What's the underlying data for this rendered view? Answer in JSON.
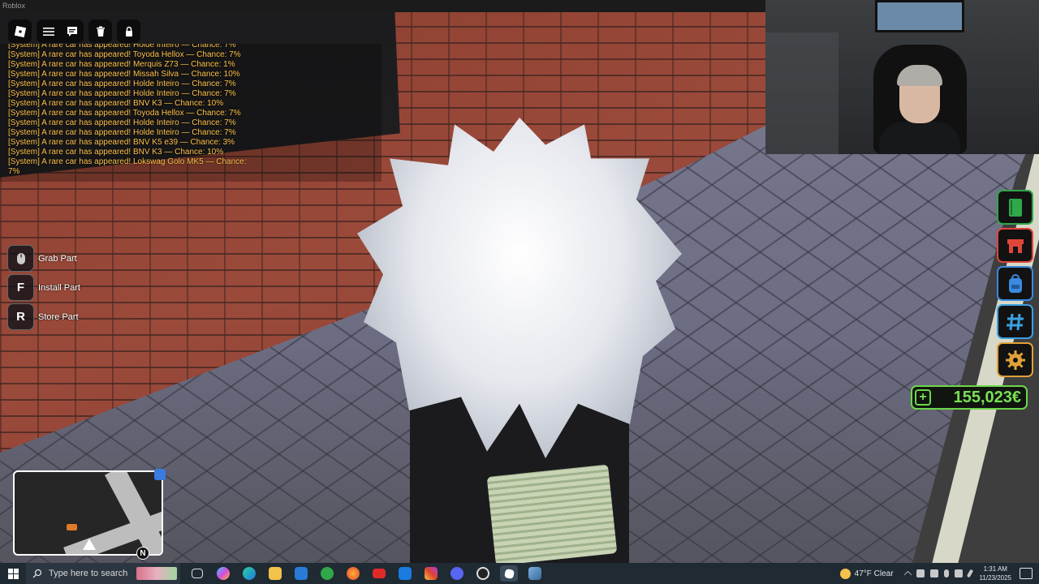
{
  "window": {
    "title": "Roblox"
  },
  "topbar": {
    "buttons": [
      {
        "icon": "roblox-logo-icon"
      },
      {
        "icon": "menu-icon"
      },
      {
        "icon": "chat-icon"
      },
      {
        "icon": "trash-icon"
      },
      {
        "icon": "lock-icon"
      }
    ]
  },
  "chat": {
    "lines": [
      "[System] A rare car has appeared! Holde Inteiro — Chance: 7%",
      "[System] A rare car has appeared! Toyoda Hellox — Chance: 7%",
      "[System] A rare car has appeared! Merquis Z73 — Chance: 1%",
      "[System] A rare car has appeared! Missah Silva — Chance: 10%",
      "[System] A rare car has appeared! Holde Inteiro — Chance: 7%",
      "[System] A rare car has appeared! Holde Inteiro — Chance: 7%",
      "[System] A rare car has appeared! BNV K3 — Chance: 10%",
      "[System] A rare car has appeared! Toyoda Hellox — Chance: 7%",
      "[System] A rare car has appeared! Holde Inteiro — Chance: 7%",
      "[System] A rare car has appeared! Holde Inteiro — Chance: 7%",
      "[System] A rare car has appeared! BNV K5 e39 — Chance: 3%",
      "[System] A rare car has appeared! BNV K3 — Chance: 10%",
      "[System] A rare car has appeared! Lokswag Golo MK5 — Chance: 7%"
    ]
  },
  "hints": [
    {
      "key": "",
      "label": "Grab Part",
      "icon": "mouse-icon"
    },
    {
      "key": "F",
      "label": "Install Part"
    },
    {
      "key": "R",
      "label": "Store Part"
    }
  ],
  "minimap": {
    "north": "N"
  },
  "side_buttons": [
    {
      "icon": "book-icon",
      "color": "#2fa84a"
    },
    {
      "icon": "shop-icon",
      "color": "#e0453a"
    },
    {
      "icon": "backpack-icon",
      "color": "#3a8ae0"
    },
    {
      "icon": "hashtag-icon",
      "color": "#3aa0e0"
    },
    {
      "icon": "gear-icon",
      "color": "#e0a03a"
    }
  ],
  "money": {
    "plus": "+",
    "value": "155,023€",
    "color": "#6cd64a"
  },
  "taskbar": {
    "search_placeholder": "Type here to search",
    "apps": [
      "task-view-icon",
      "copilot-icon",
      "edge-icon",
      "file-explorer-icon",
      "store-icon",
      "xbox-icon",
      "firefox-icon",
      "youtube-icon",
      "outlook-icon",
      "instagram-icon",
      "discord-icon",
      "obs-icon",
      "roblox-taskbar-icon",
      "photos-icon"
    ],
    "weather": "47°F  Clear",
    "time": "1:31 AM",
    "date": "11/23/2025"
  }
}
